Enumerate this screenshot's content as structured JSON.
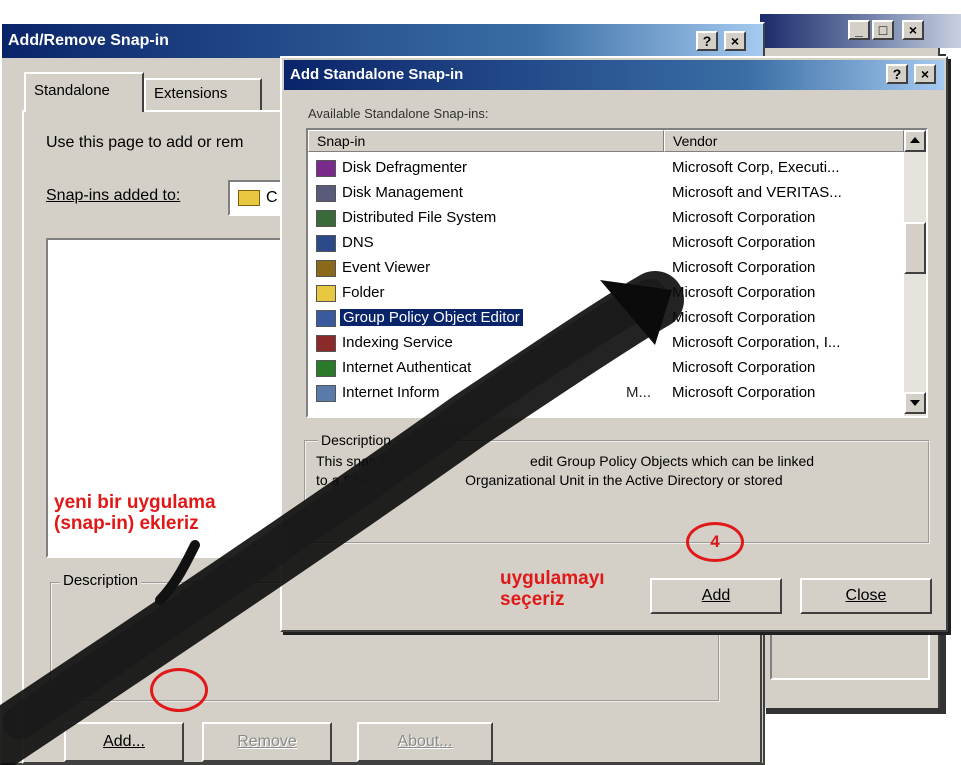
{
  "add_remove_dialog": {
    "title": "Add/Remove Snap-in",
    "help_btn": "?",
    "close_btn": "×",
    "tabs": [
      "Standalone",
      "Extensions"
    ],
    "intro_text": "Use this page to add or rem",
    "snapins_added_label": "Snap-ins added to:",
    "snapins_added_value": "C",
    "description_label": "Description",
    "buttons": {
      "add": "Add...",
      "remove": "Remove",
      "about": "About..."
    }
  },
  "outer_window": {
    "minimize": "_",
    "maximize": "□",
    "close": "×"
  },
  "add_standalone_dialog": {
    "title": "Add Standalone Snap-in",
    "help_btn": "?",
    "close_btn": "×",
    "available_label": "Available Standalone Snap-ins:",
    "columns": {
      "snapin": "Snap-in",
      "vendor": "Vendor"
    },
    "rows": [
      {
        "name": "Disk Defragmenter",
        "vendor": "Microsoft Corp, Executi...",
        "icon": "defrag-icon",
        "color": "#7a2a8a"
      },
      {
        "name": "Disk Management",
        "vendor": "Microsoft and VERITAS...",
        "icon": "disk-icon",
        "color": "#5a5a7a"
      },
      {
        "name": "Distributed File System",
        "vendor": "Microsoft Corporation",
        "icon": "dfs-icon",
        "color": "#3a6a3a"
      },
      {
        "name": "DNS",
        "vendor": "Microsoft Corporation",
        "icon": "dns-icon",
        "color": "#2a4a8a"
      },
      {
        "name": "Event Viewer",
        "vendor": "Microsoft Corporation",
        "icon": "event-viewer-icon",
        "color": "#8a6a1a"
      },
      {
        "name": "Folder",
        "vendor": "Microsoft Corporation",
        "icon": "folder-icon",
        "color": "#e8c840"
      },
      {
        "name": "Group Policy Object Editor",
        "vendor": "Microsoft Corporation",
        "icon": "group-policy-icon",
        "color": "#3a5aa0",
        "selected": true
      },
      {
        "name": "Indexing Service",
        "vendor": "Microsoft Corporation, I...",
        "icon": "indexing-icon",
        "color": "#8a2a2a"
      },
      {
        "name": "Internet Authenticat",
        "vendor": "Microsoft Corporation",
        "icon": "ias-icon",
        "color": "#2a7a2a"
      },
      {
        "name": "Internet Inform",
        "vendor": "Microsoft Corporation",
        "icon": "iis-icon",
        "color": "#5a7aaa"
      }
    ],
    "row_name_tail": "M...",
    "description_label": "Description",
    "description_line1_a": "This snap-in",
    "description_line1_b": "edit Group Policy Objects which can be linked",
    "description_line2_a": "to a Site",
    "description_line2_b": "Organizational Unit in the Active Directory or stored",
    "buttons": {
      "add": "Add",
      "close": "Close"
    }
  },
  "annotations": {
    "left_note": [
      "yeni bir uygulama",
      "(snap-in) ekleriz"
    ],
    "right_note": [
      "uygulamayı",
      "seçeriz"
    ],
    "step_number": "4"
  }
}
